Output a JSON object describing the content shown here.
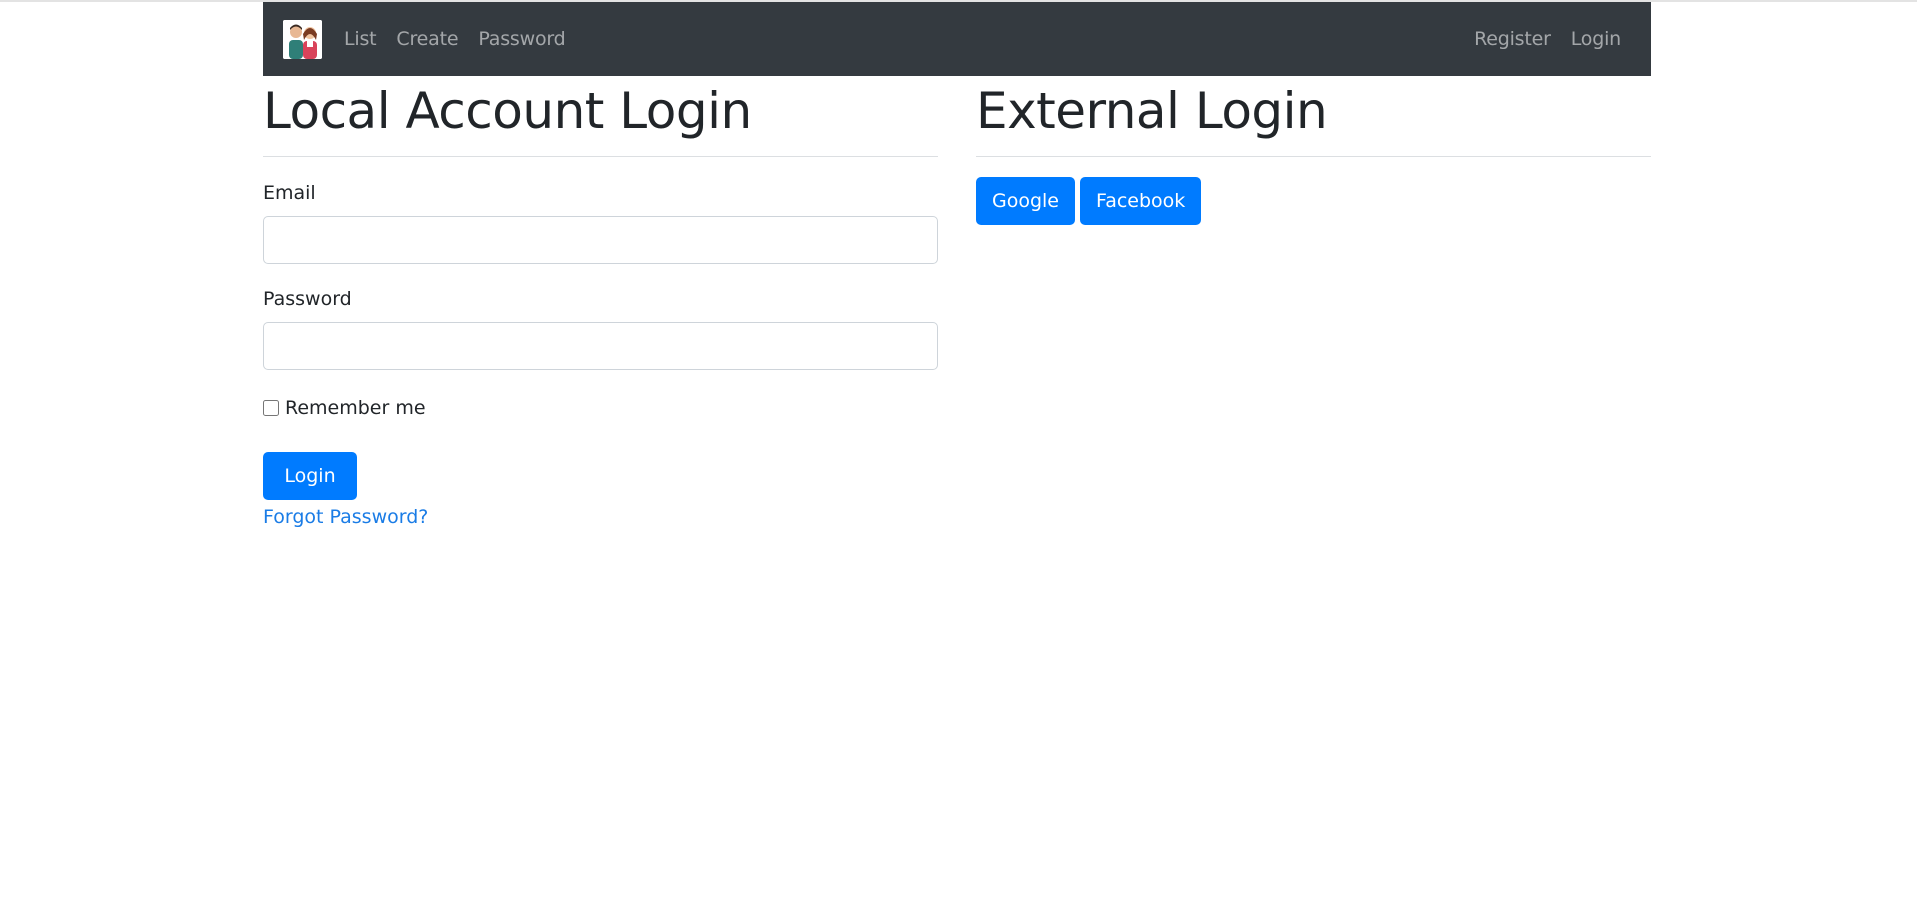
{
  "navbar": {
    "brand_icon": "people-avatar-logo",
    "left_links": [
      "List",
      "Create",
      "Password"
    ],
    "right_links": [
      "Register",
      "Login"
    ]
  },
  "local": {
    "title": "Local Account Login",
    "email_label": "Email",
    "email_value": "",
    "password_label": "Password",
    "password_value": "",
    "remember_label": "Remember me",
    "remember_checked": false,
    "login_button": "Login",
    "forgot_link": "Forgot Password?"
  },
  "external": {
    "title": "External Login",
    "providers": [
      "Google",
      "Facebook"
    ]
  },
  "colors": {
    "navbar_bg": "#343a40",
    "primary": "#007bff",
    "link": "#1a7ce6"
  }
}
